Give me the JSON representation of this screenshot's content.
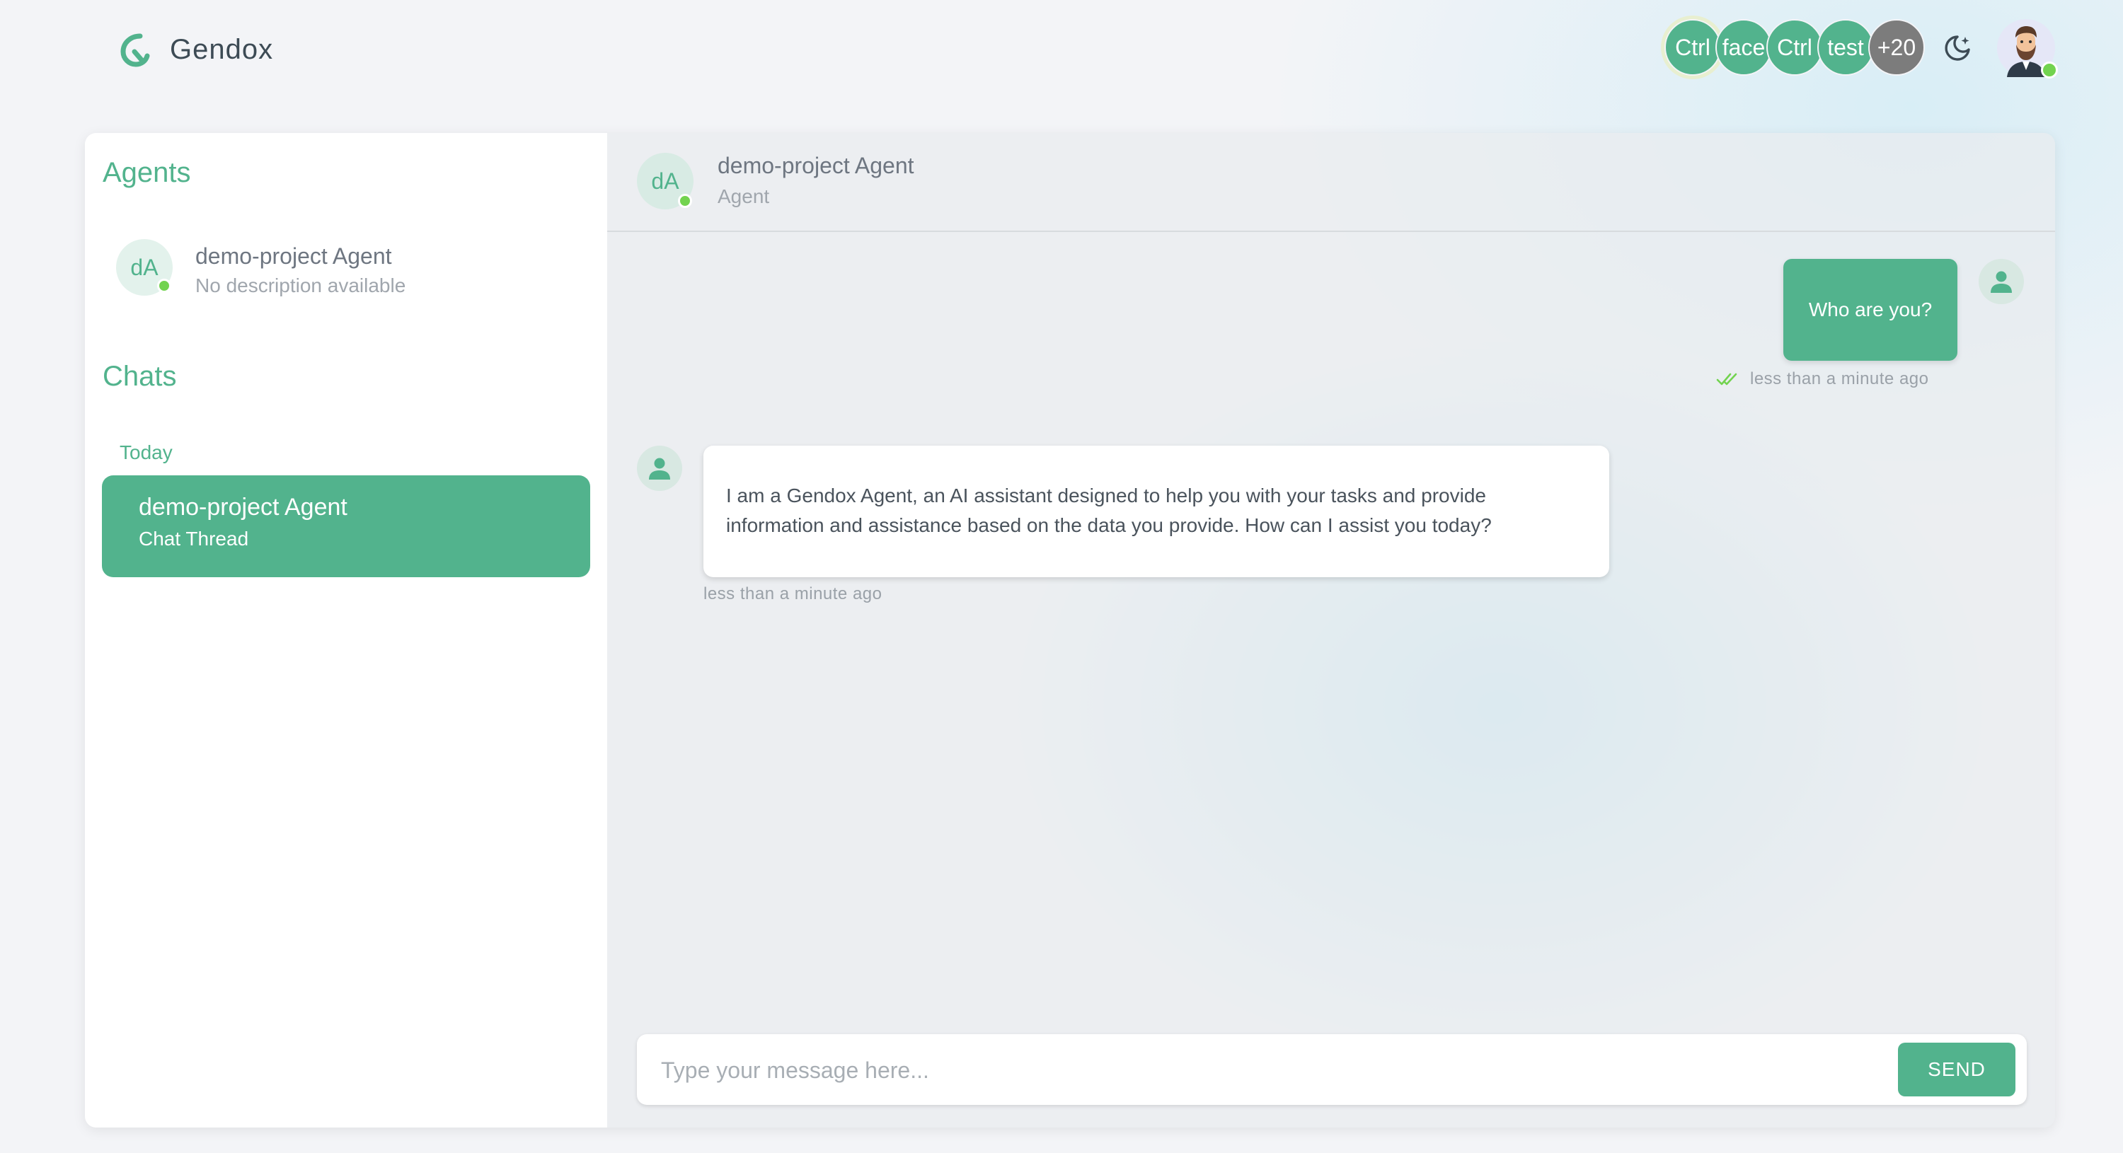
{
  "app": {
    "name": "Gendox",
    "accent_color": "#52b38d"
  },
  "header": {
    "organizations": [
      {
        "label": "Ctrl",
        "active": true
      },
      {
        "label": "face",
        "active": false
      },
      {
        "label": "Ctrl",
        "active": false
      },
      {
        "label": "test",
        "active": false
      }
    ],
    "more_organizations": "+20",
    "theme_icon": "moon-icon",
    "user_avatar_icon": "bearded-man-avatar"
  },
  "sidebar": {
    "agents_title": "Agents",
    "agents": [
      {
        "initials": "dA",
        "name": "demo-project Agent",
        "description": "No description available",
        "online": true
      }
    ],
    "chats_title": "Chats",
    "chat_groups": [
      {
        "label": "Today",
        "threads": [
          {
            "title": "demo-project Agent",
            "subtitle": "Chat Thread",
            "selected": true
          }
        ]
      }
    ]
  },
  "chat": {
    "agent": {
      "initials": "dA",
      "name": "demo-project Agent",
      "role": "Agent"
    },
    "messages": [
      {
        "sender": "user",
        "text": "Who are you?",
        "time": "less than a minute ago",
        "status_icon": "double-check-icon"
      },
      {
        "sender": "agent",
        "text": "I am a Gendox Agent, an AI assistant designed to help you with your tasks and provide information and assistance based on the data you provide. How can I assist you today?",
        "time": "less than a minute ago"
      }
    ],
    "composer": {
      "placeholder": "Type your message here...",
      "value": "",
      "send_label": "SEND"
    }
  }
}
